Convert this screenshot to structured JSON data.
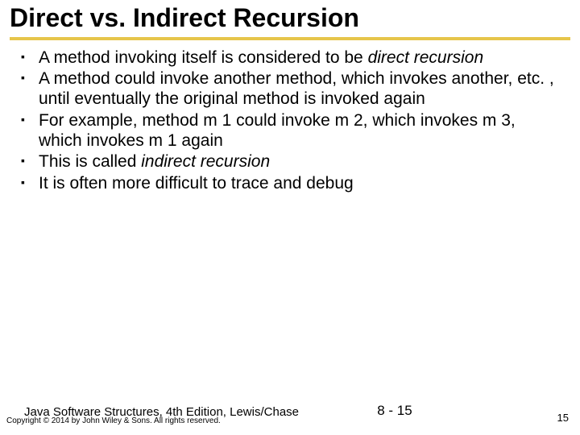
{
  "title": "Direct vs. Indirect Recursion",
  "bullets": {
    "b1a": "A method invoking itself is considered to be ",
    "b1b": "direct recursion",
    "b2": "A method could invoke another method, which invokes another, etc. , until eventually the original method is invoked again",
    "b3": "For example, method m 1 could invoke m 2, which invokes m 3, which invokes m 1 again",
    "b4a": "This is called ",
    "b4b": "indirect recursion",
    "b5": "It is often more difficult to trace and debug"
  },
  "footer": {
    "book": "Java Software Structures, 4th Edition, Lewis/Chase",
    "copyright": "Copyright © 2014 by John Wiley & Sons.  All rights reserved.",
    "page_center": "8 - 15",
    "page_right": "15"
  }
}
